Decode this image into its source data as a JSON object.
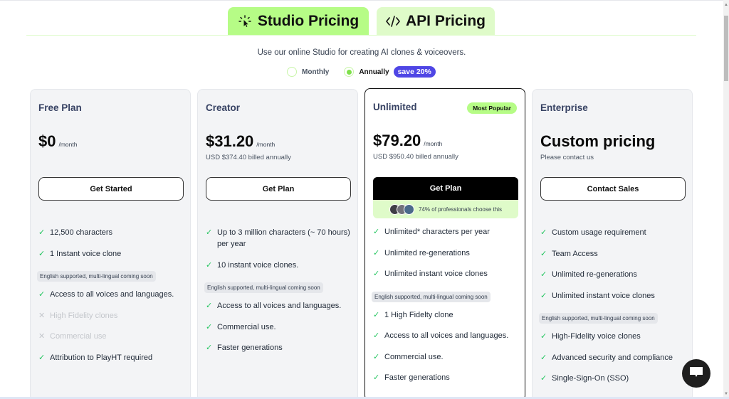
{
  "tabs": [
    {
      "label": "Studio Pricing",
      "icon": "sparkle-cursor-icon",
      "active": true
    },
    {
      "label": "API Pricing",
      "icon": "code-icon",
      "active": false
    }
  ],
  "subtitle": "Use our online Studio for creating AI clones & voiceovers.",
  "billing": {
    "monthly_label": "Monthly",
    "annually_label": "Annually",
    "selected": "Annually",
    "save_badge": "save 20%"
  },
  "colors": {
    "accent_green": "#b6fc86",
    "light_green": "#dffbc9",
    "badge_purple": "#4f46e5",
    "check_green": "#22c55e"
  },
  "plans": [
    {
      "name": "Free Plan",
      "price": "$0",
      "period": "/month",
      "billed": "",
      "cta": "Get Started",
      "features": [
        {
          "text": "12,500 characters",
          "included": true
        },
        {
          "text": "1 Instant voice clone",
          "included": true,
          "note": "English supported, multi-lingual coming soon"
        },
        {
          "text": "Access to all voices and languages.",
          "included": true
        },
        {
          "text": "High Fidelity clones",
          "included": false
        },
        {
          "text": "Commercial use",
          "included": false
        },
        {
          "text": "Attribution to PlayHT required",
          "included": true
        }
      ]
    },
    {
      "name": "Creator",
      "price": "$31.20",
      "period": "/month",
      "billed": "USD $374.40 billed annually",
      "cta": "Get Plan",
      "features": [
        {
          "text": "Up to 3 million characters (~ 70 hours) per year",
          "included": true
        },
        {
          "text": "10 instant voice clones.",
          "included": true,
          "note": "English supported, multi-lingual coming soon"
        },
        {
          "text": "Access to all voices and languages.",
          "included": true
        },
        {
          "text": "Commercial use.",
          "included": true
        },
        {
          "text": "Faster generations",
          "included": true
        }
      ]
    },
    {
      "name": "Unlimited",
      "badge": "Most Popular",
      "price": "$79.20",
      "period": "/month",
      "billed": "USD $950.40 billed annually",
      "cta": "Get Plan",
      "social_proof": "74% of professionals choose this",
      "features": [
        {
          "text": "Unlimited* characters per year",
          "included": true
        },
        {
          "text": "Unlimited re-generations",
          "included": true
        },
        {
          "text": "Unlimited instant voice clones",
          "included": true,
          "note": "English supported, multi-lingual coming soon"
        },
        {
          "text": "1 High Fidelty clone",
          "included": true
        },
        {
          "text": "Access to all voices and languages.",
          "included": true
        },
        {
          "text": "Commercial use.",
          "included": true
        },
        {
          "text": "Faster generations",
          "included": true
        }
      ]
    },
    {
      "name": "Enterprise",
      "price": "Custom pricing",
      "billed": "Please contact us",
      "cta": "Contact Sales",
      "features": [
        {
          "text": "Custom usage requirement",
          "included": true
        },
        {
          "text": "Team Access",
          "included": true
        },
        {
          "text": "Unlimited re-generations",
          "included": true
        },
        {
          "text": "Unlimited instant voice clones",
          "included": true,
          "note": "English supported, multi-lingual coming soon"
        },
        {
          "text": "High-Fidelity voice clones",
          "included": true
        },
        {
          "text": "Advanced security and compliance",
          "included": true
        },
        {
          "text": "Single-Sign-On (SSO)",
          "included": true
        }
      ]
    }
  ],
  "chat_button_icon": "chat-icon"
}
